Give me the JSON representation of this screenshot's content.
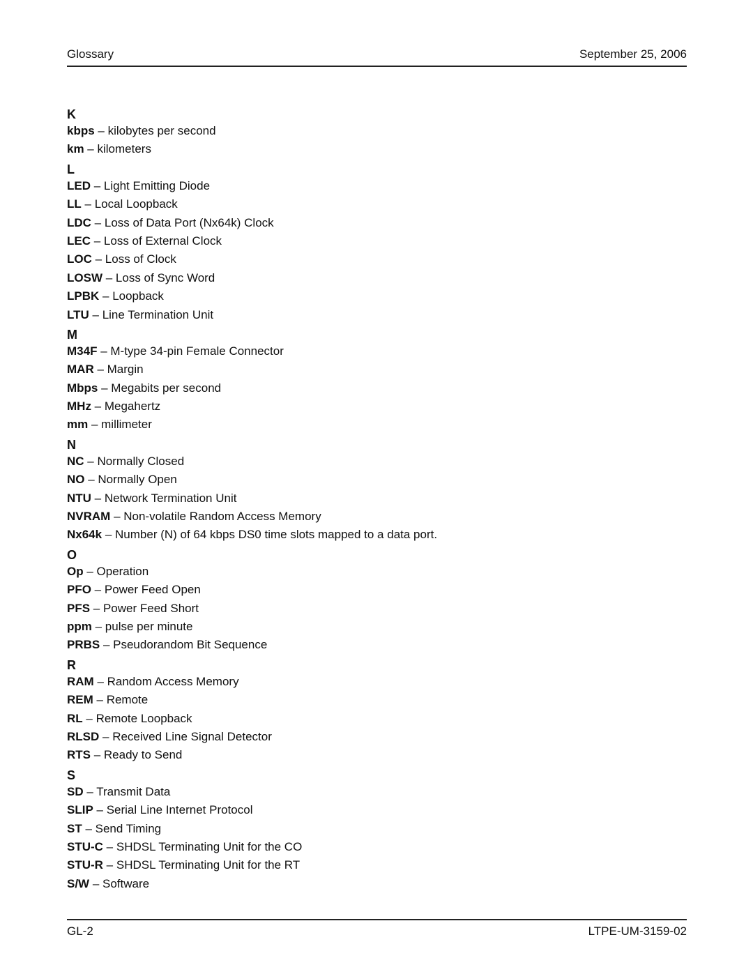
{
  "header": {
    "title": "Glossary",
    "date": "September 25, 2006"
  },
  "sections": [
    {
      "letter": "K",
      "entries": [
        {
          "term": "kbps",
          "definition": "kilobytes per second"
        },
        {
          "term": "km",
          "definition": "kilometers"
        }
      ]
    },
    {
      "letter": "L",
      "entries": [
        {
          "term": "LED",
          "definition": "Light Emitting Diode"
        },
        {
          "term": "LL",
          "definition": "Local Loopback"
        },
        {
          "term": "LDC",
          "definition": "Loss of Data Port (Nx64k) Clock"
        },
        {
          "term": "LEC",
          "definition": "Loss of External Clock"
        },
        {
          "term": "LOC",
          "definition": "Loss of Clock"
        },
        {
          "term": "LOSW",
          "definition": "Loss of Sync Word"
        },
        {
          "term": "LPBK",
          "definition": "Loopback"
        },
        {
          "term": "LTU",
          "definition": "Line Termination Unit"
        }
      ]
    },
    {
      "letter": "M",
      "entries": [
        {
          "term": "M34F",
          "definition": "M-type 34-pin Female Connector"
        },
        {
          "term": "MAR",
          "definition": "Margin"
        },
        {
          "term": "Mbps",
          "definition": "Megabits per second"
        },
        {
          "term": "MHz",
          "definition": "Megahertz"
        },
        {
          "term": "mm",
          "definition": "millimeter"
        }
      ]
    },
    {
      "letter": "N",
      "entries": [
        {
          "term": "NC",
          "definition": "Normally Closed"
        },
        {
          "term": "NO",
          "definition": "Normally Open"
        },
        {
          "term": "NTU",
          "definition": "Network Termination Unit"
        },
        {
          "term": "NVRAM",
          "definition": "Non-volatile Random Access Memory"
        },
        {
          "term": "Nx64k",
          "definition": "Number (N) of 64 kbps DS0 time slots mapped to a data port."
        }
      ]
    },
    {
      "letter": "O",
      "entries": [
        {
          "term": "Op",
          "definition": "Operation"
        },
        {
          "term": "PFO",
          "definition": "Power Feed Open"
        },
        {
          "term": "PFS",
          "definition": "Power Feed Short"
        },
        {
          "term": "ppm",
          "definition": "pulse per minute"
        },
        {
          "term": "PRBS",
          "definition": "Pseudorandom Bit Sequence"
        }
      ]
    },
    {
      "letter": "R",
      "entries": [
        {
          "term": "RAM",
          "definition": "Random Access Memory"
        },
        {
          "term": "REM",
          "definition": "Remote"
        },
        {
          "term": "RL",
          "definition": "Remote Loopback"
        },
        {
          "term": "RLSD",
          "definition": "Received Line Signal Detector"
        },
        {
          "term": "RTS",
          "definition": "Ready to Send"
        }
      ]
    },
    {
      "letter": "S",
      "entries": [
        {
          "term": "SD",
          "definition": "Transmit Data"
        },
        {
          "term": "SLIP",
          "definition": "Serial Line Internet Protocol"
        },
        {
          "term": "ST",
          "definition": "Send Timing"
        },
        {
          "term": "STU-C",
          "definition": "SHDSL Terminating Unit for the CO"
        },
        {
          "term": "STU-R",
          "definition": "SHDSL Terminating Unit for the RT"
        },
        {
          "term": "S/W",
          "definition": "Software"
        }
      ]
    }
  ],
  "separator": " – ",
  "footer": {
    "page_number": "GL-2",
    "document_id": "LTPE-UM-3159-02"
  }
}
